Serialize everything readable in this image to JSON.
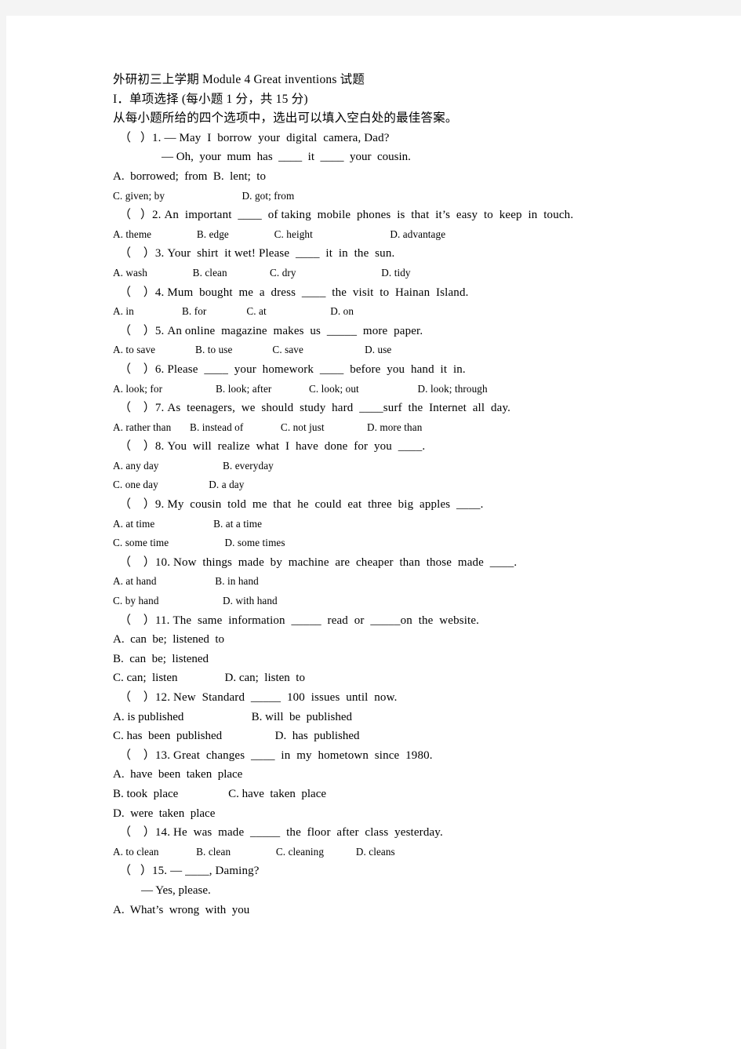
{
  "document": {
    "title": "外研初三上学期 Module 4 Great inventions 试题",
    "section_heading": "I．单项选择 (每小题 1 分，共 15 分)",
    "instruction": "从每小题所给的四个选项中，选出可以填入空白处的最佳答案。",
    "lines": [
      {
        "id": "title",
        "style": "big",
        "text": "外研初三上学期 Module 4 Great inventions 试题"
      },
      {
        "id": "section",
        "style": "big",
        "text": "I．单项选择 (每小题 1 分，共 15 分)"
      },
      {
        "id": "instruction",
        "style": "big",
        "text": "从每小题所给的四个选项中，选出可以填入空白处的最佳答案。"
      },
      {
        "id": "q1-stem",
        "style": "q",
        "text": "（   ）1. — May  I  borrow  your  digital  camera, Dad?"
      },
      {
        "id": "q1-reply",
        "style": "cont",
        "text": "— Oh,  your  mum  has  ____  it  ____  your  cousin."
      },
      {
        "id": "q1-opt-ab",
        "style": "optbig",
        "text": "A.  borrowed;  from  B.  lent;  to"
      },
      {
        "id": "q1-opt-cd",
        "style": "opt",
        "text": "C. given; by                             D. got; from"
      },
      {
        "id": "q2-stem",
        "style": "q",
        "text": "（   ）2. An  important  ____  of taking  mobile  phones  is  that  it’s  easy  to  keep  in  touch."
      },
      {
        "id": "q2-opts",
        "style": "opt",
        "text": "A. theme                 B. edge                 C. height                             D. advantage"
      },
      {
        "id": "q3-stem",
        "style": "q",
        "text": "（    ）3. Your  shirt  it wet! Please  ____  it  in  the  sun."
      },
      {
        "id": "q3-opts",
        "style": "opt",
        "text": "A. wash                 B. clean                C. dry                                D. tidy"
      },
      {
        "id": "q4-stem",
        "style": "q",
        "text": "（    ）4. Mum  bought  me  a  dress  ____  the  visit  to  Hainan  Island."
      },
      {
        "id": "q4-opts",
        "style": "opt",
        "text": "A. in                  B. for               C. at                        D. on"
      },
      {
        "id": "q5-stem",
        "style": "q",
        "text": "（    ）5. An online  magazine  makes  us  _____  more  paper."
      },
      {
        "id": "q5-opts",
        "style": "opt",
        "text": "A. to save               B. to use               C. save                       D. use"
      },
      {
        "id": "q6-stem",
        "style": "q",
        "text": "（    ）6. Please  ____  your  homework  ____  before  you  hand  it  in."
      },
      {
        "id": "q6-opts",
        "style": "opt",
        "text": "A. look; for                    B. look; after              C. look; out                      D. look; through"
      },
      {
        "id": "q7-stem",
        "style": "q",
        "text": "（    ）7. As  teenagers,  we  should  study  hard  ____surf  the  Internet  all  day."
      },
      {
        "id": "q7-opts",
        "style": "opt",
        "text": "A. rather than       B. instead of              C. not just                D. more than"
      },
      {
        "id": "q8-stem",
        "style": "q",
        "text": "（    ）8. You  will  realize  what  I  have  done  for  you  ____."
      },
      {
        "id": "q8-opt-ab",
        "style": "opt",
        "text": "A. any day                        B. everyday"
      },
      {
        "id": "q8-opt-cd",
        "style": "opt",
        "text": "C. one day                   D. a day"
      },
      {
        "id": "q9-stem",
        "style": "q",
        "text": "（    ）9. My  cousin  told  me  that  he  could  eat  three  big  apples  ____."
      },
      {
        "id": "q9-opt-ab",
        "style": "opt",
        "text": "A. at time                      B. at a time"
      },
      {
        "id": "q9-opt-cd",
        "style": "opt",
        "text": "C. some time                     D. some times"
      },
      {
        "id": "q10-stem",
        "style": "q",
        "text": "（    ）10. Now  things  made  by  machine  are  cheaper  than  those  made  ____."
      },
      {
        "id": "q10-opt-ab",
        "style": "opt",
        "text": "A. at hand                      B. in hand"
      },
      {
        "id": "q10-opt-cd",
        "style": "opt",
        "text": "C. by hand                        D. with hand"
      },
      {
        "id": "q11-stem",
        "style": "q",
        "text": "（    ）11. The  same  information  _____  read  or  _____on  the  website."
      },
      {
        "id": "q11-opt-a",
        "style": "optbig",
        "text": "A.  can  be;  listened  to"
      },
      {
        "id": "q11-opt-b",
        "style": "optbig",
        "text": "B.  can  be;  listened"
      },
      {
        "id": "q11-opt-cd",
        "style": "optbig",
        "text": "C. can;  listen                D. can;  listen  to"
      },
      {
        "id": "q12-stem",
        "style": "q",
        "text": "（    ）12. New  Standard  _____  100  issues  until  now."
      },
      {
        "id": "q12-opt-ab",
        "style": "optbig",
        "text": "A. is published                       B. will  be  published"
      },
      {
        "id": "q12-opt-cd",
        "style": "optbig",
        "text": "C. has  been  published                  D.  has  published"
      },
      {
        "id": "q13-stem",
        "style": "q",
        "text": "（    ）13. Great  changes  ____  in  my  hometown  since  1980."
      },
      {
        "id": "q13-opt-a",
        "style": "optbig",
        "text": "A.  have  been  taken  place"
      },
      {
        "id": "q13-opt-bc",
        "style": "optbig",
        "text": "B. took  place                 C. have  taken  place"
      },
      {
        "id": "q13-opt-d",
        "style": "optbig",
        "text": "D.  were  taken  place"
      },
      {
        "id": "q14-stem",
        "style": "q",
        "text": "（    ）14. He  was  made  _____  the  floor  after  class  yesterday."
      },
      {
        "id": "q14-opts",
        "style": "opt",
        "text": "A. to clean              B. clean                 C. cleaning            D. cleans"
      },
      {
        "id": "q15-stem",
        "style": "q",
        "text": "（   ）15. — ____, Daming?"
      },
      {
        "id": "q15-reply",
        "style": "cont2",
        "text": "— Yes, please."
      },
      {
        "id": "q15-opt-a",
        "style": "optbig",
        "text": "A.  What’s  wrong  with  you"
      }
    ]
  }
}
